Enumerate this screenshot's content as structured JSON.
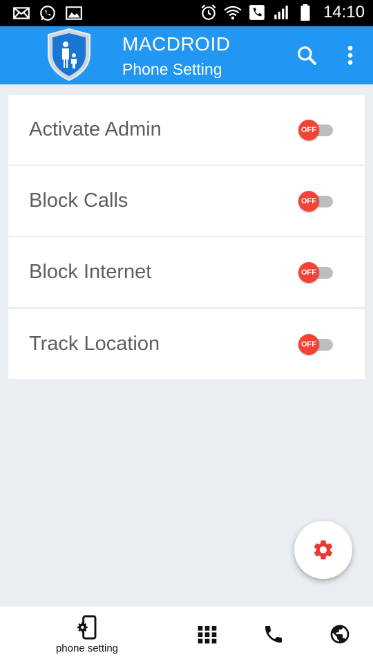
{
  "status_bar": {
    "time": "14:10",
    "icons": [
      "mail-icon",
      "whatsapp-icon",
      "gallery-icon",
      "alarm-icon",
      "wifi-icon",
      "call-icon",
      "signal-icon",
      "battery-icon"
    ]
  },
  "app_bar": {
    "title": "MACDROID",
    "subtitle": "Phone Setting",
    "logo_icon": "shield-family-icon",
    "actions": [
      "search-icon",
      "more-vert-icon"
    ],
    "color": "#2196f3"
  },
  "settings": [
    {
      "label": "Activate Admin",
      "toggle": "OFF"
    },
    {
      "label": "Block Calls",
      "toggle": "OFF"
    },
    {
      "label": "Block Internet",
      "toggle": "OFF"
    },
    {
      "label": "Track Location",
      "toggle": "OFF"
    }
  ],
  "fab": {
    "icon": "gear-icon",
    "color": "#e53935"
  },
  "bottom_nav": {
    "phone_setting_label": "phone setting",
    "items": [
      "phone-setting-icon",
      "apps-grid-icon",
      "phone-icon",
      "globe-icon"
    ]
  },
  "colors": {
    "toggle_off": "#f44336",
    "background": "#eaeef2",
    "text": "#5e5e5e"
  }
}
